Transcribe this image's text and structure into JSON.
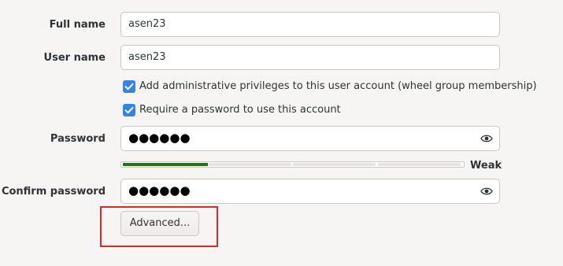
{
  "form": {
    "full_name_label": "Full name",
    "full_name_value": "asen23",
    "user_name_label": "User name",
    "user_name_value": "asen23",
    "admin_checkbox_label": "Add administrative privileges to this user account (wheel group membership)",
    "admin_checked": true,
    "require_password_label": "Require a password to use this account",
    "require_password_checked": true,
    "password_label": "Password",
    "password_value": "●●●●●●",
    "strength_text": "Weak",
    "strength_level": 0.25,
    "confirm_label": "Confirm password",
    "confirm_value": "●●●●●●",
    "advanced_button": "Advanced..."
  },
  "colors": {
    "accent": "#3584e4",
    "strength_fill": "#26721a",
    "highlight": "#d92a2a"
  },
  "icons": [
    "checkbox-checked-icon",
    "eye-icon"
  ]
}
